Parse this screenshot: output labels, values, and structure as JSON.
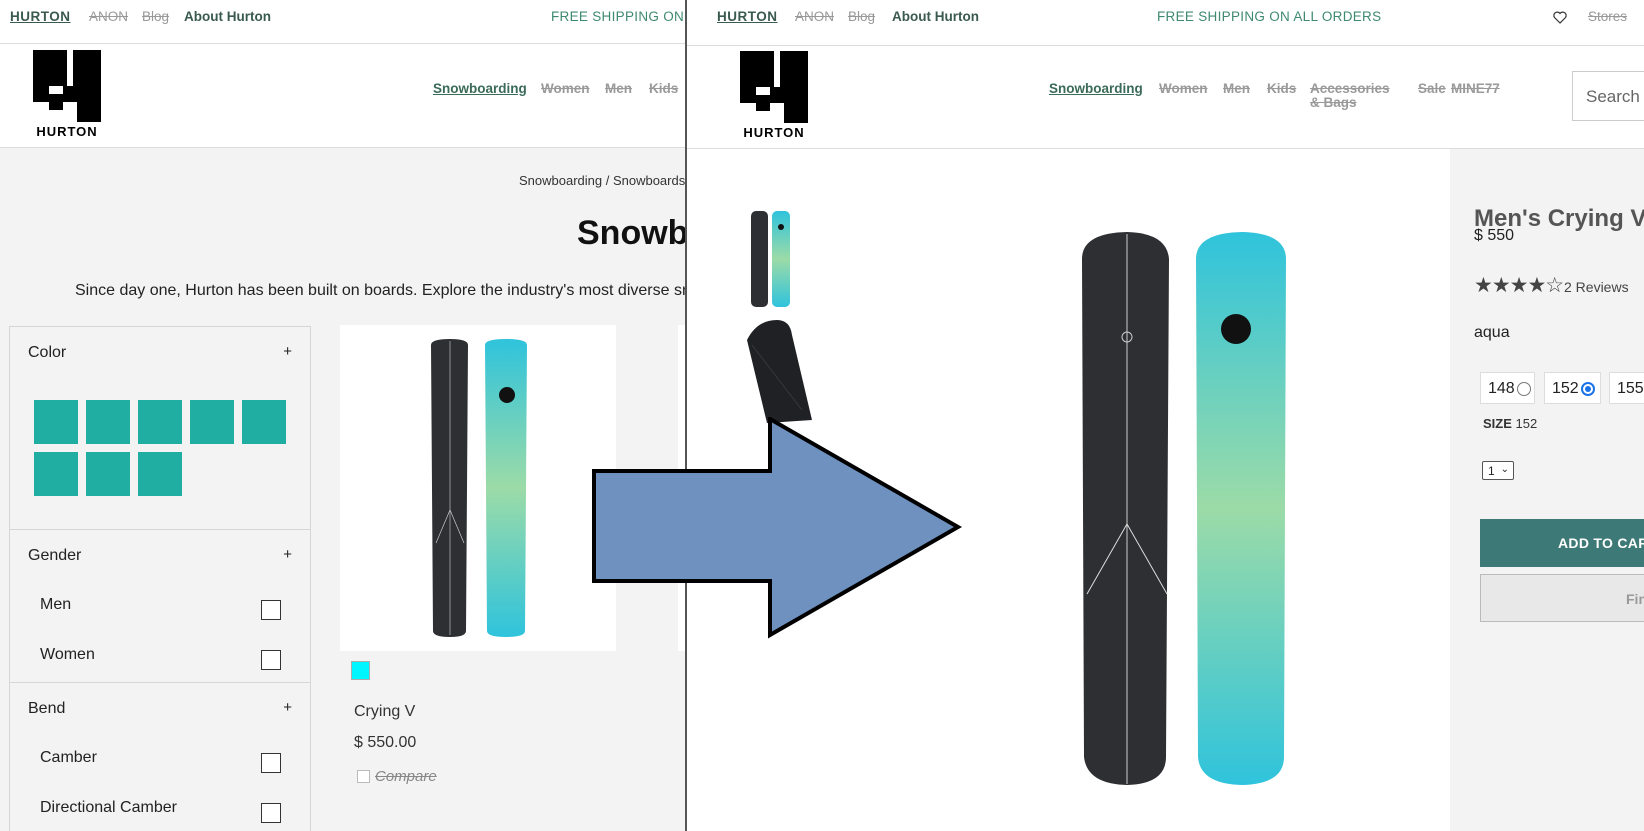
{
  "topbar": {
    "brand": "HURTON",
    "anon": "ANON",
    "blog": "Blog",
    "about": "About Hurton",
    "shipping_left": "FREE SHIPPING ON",
    "shipping_right": "FREE SHIPPING ON ALL ORDERS",
    "stores": "Stores"
  },
  "logo": {
    "word": "HURTON"
  },
  "nav_left": [
    "Snowboarding",
    "Women",
    "Men",
    "Kids"
  ],
  "nav_right": [
    "Snowboarding",
    "Women",
    "Men",
    "Kids",
    "Accessories",
    "& Bags",
    "Sale",
    "MINE77"
  ],
  "search": {
    "placeholder": "Search"
  },
  "listing": {
    "breadcrumb": "Snowboarding / Snowboards",
    "title": "Snowbo",
    "intro": "Since day one, Hurton has been built on boards. Explore the industry's most diverse sn",
    "filters": {
      "color": {
        "label": "Color",
        "toggle": "+",
        "swatch_color": "#20aea2",
        "swatch_count": 8
      },
      "gender": {
        "label": "Gender",
        "toggle": "+",
        "options": [
          "Men",
          "Women"
        ]
      },
      "bend": {
        "label": "Bend",
        "toggle": "+",
        "options": [
          "Camber",
          "Directional Camber"
        ]
      }
    },
    "product": {
      "color_swatch": "#00f5ff",
      "name": "Crying V",
      "price": "$ 550.00",
      "compare": "Compare"
    }
  },
  "product_page": {
    "title": "Men's Crying V",
    "price": "$ 550",
    "rating": 4,
    "stars": "★★★★☆",
    "reviews": "2 Reviews",
    "color": "aqua",
    "sizes": [
      {
        "value": "148",
        "selected": false
      },
      {
        "value": "152",
        "selected": true
      },
      {
        "value": "155",
        "selected": false
      }
    ],
    "size_label": "SIZE",
    "size_value": "152",
    "quantity": "1",
    "add_to_cart": "ADD TO CART",
    "find": "Find"
  },
  "colors": {
    "brand_green": "#3a5a4f",
    "shipping_green": "#3f8a6f",
    "teal_button": "#3d7a77",
    "arrow_fill": "#6e91bf"
  }
}
